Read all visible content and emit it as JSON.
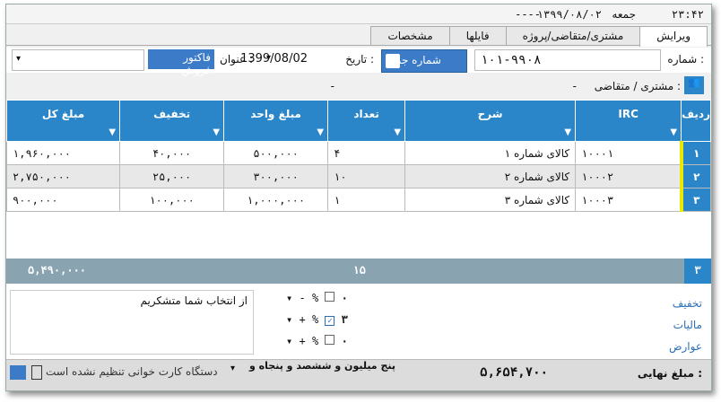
{
  "statusbar": {
    "time": "۲۳:۴۲",
    "weekday": "جمعه",
    "date": "۱۳۹۹/۰۸/۰۲",
    "dash": "----"
  },
  "tabs": [
    "ویرایش",
    "مشتری/متقاضی/پروژه",
    "فایلها",
    "مشخصات"
  ],
  "header": {
    "number_label": "شماره :",
    "number_value": "۱۰۱-۹۹۰۸",
    "new_number_label": "شماره جدید",
    "date_label": "تاریخ :",
    "date_value": "1399/08/02",
    "title_label": "عنوان :",
    "title_value": "فاکتور فروش",
    "customer_label": "مشتری / متقاضی :",
    "customer_value": "-",
    "customer_extra": "-"
  },
  "table": {
    "columns": [
      "ردیف",
      "IRC",
      "شرح",
      "تعداد",
      "مبلغ واحد",
      "تخفیف",
      "مبلغ کل"
    ],
    "rows": [
      {
        "no": "۱",
        "irc": "۱۰۰۰۱",
        "desc": "کالای شماره ۱",
        "qty": "۴",
        "unit": "۵۰۰,۰۰۰",
        "disc": "۴۰,۰۰۰",
        "total": "۱,۹۶۰,۰۰۰"
      },
      {
        "no": "۲",
        "irc": "۱۰۰۰۲",
        "desc": "کالای شماره ۲",
        "qty": "۱۰",
        "unit": "۳۰۰,۰۰۰",
        "disc": "۲۵,۰۰۰",
        "total": "۲,۷۵۰,۰۰۰"
      },
      {
        "no": "۳",
        "irc": "۱۰۰۰۳",
        "desc": "کالای شماره ۳",
        "qty": "۱",
        "unit": "۱,۰۰۰,۰۰۰",
        "disc": "۱۰۰,۰۰۰",
        "total": "۹۰۰,۰۰۰"
      }
    ],
    "totals": {
      "count": "۳",
      "qty": "۱۵",
      "total": "۵,۴۹۰,۰۰۰"
    }
  },
  "adjust": {
    "discount_label": "تخفیف",
    "tax_label": "مالیات",
    "duties_label": "عوارض",
    "discount_value": "۰",
    "tax_value": "۳",
    "duties_value": "۰",
    "percent": "%",
    "minus": "-",
    "plus": "+"
  },
  "note": "از انتخاب شما متشکریم",
  "footer": {
    "final_label": "مبلغ نهایی :",
    "final_value": "۵,۶۵۴,۷۰۰",
    "in_words": "پنج میلیون و ششصد و پنجاه و",
    "card_reader": "دستگاه کارت خوانی تنظیم نشده است"
  }
}
